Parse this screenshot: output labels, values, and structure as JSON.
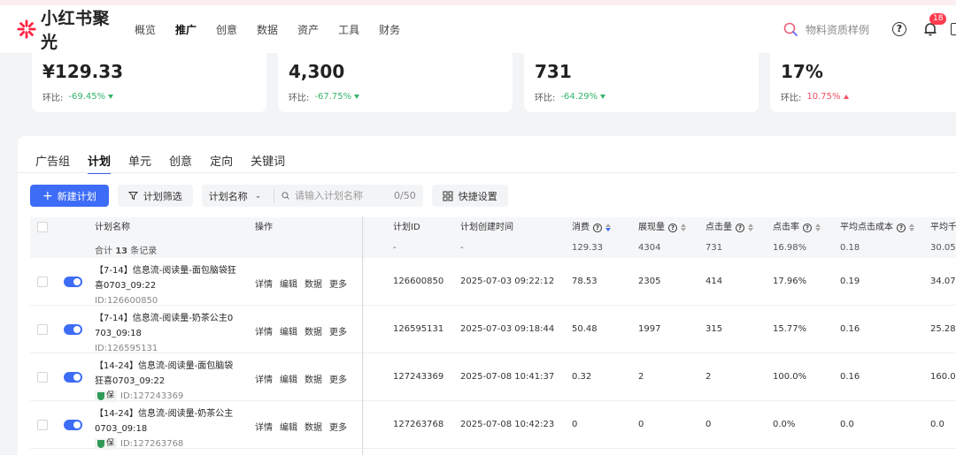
{
  "header": {
    "logo_text": "小红书聚光",
    "nav": [
      "概览",
      "推广",
      "创意",
      "数据",
      "资产",
      "工具",
      "财务"
    ],
    "active_nav": "推广",
    "search_placeholder": "物料资质样例",
    "notification_count": "18",
    "colors": {
      "brand": "#ff2442",
      "primary": "#3d6cf6"
    }
  },
  "metrics": [
    {
      "value": "¥129.33",
      "cmp_label": "环比:",
      "cmp_value": "-69.45%",
      "trend": "down"
    },
    {
      "value": "4,300",
      "cmp_label": "环比:",
      "cmp_value": "-67.75%",
      "trend": "down"
    },
    {
      "value": "731",
      "cmp_label": "环比:",
      "cmp_value": "-64.29%",
      "trend": "down"
    },
    {
      "value": "17%",
      "cmp_label": "环比:",
      "cmp_value": "10.75%",
      "trend": "up"
    }
  ],
  "tabs": [
    "广告组",
    "计划",
    "单元",
    "创意",
    "定向",
    "关键词"
  ],
  "active_tab": "计划",
  "toolbar": {
    "new_plan": "新建计划",
    "filter": "计划筛选",
    "search_field": "计划名称",
    "search_placeholder": "请输入计划名称",
    "search_count": "0/50",
    "quick_settings": "快捷设置"
  },
  "table": {
    "columns": {
      "name": "计划名称",
      "ops": "操作",
      "id": "计划ID",
      "created": "计划创建时间",
      "cost": "消费",
      "impressions": "展现量",
      "clicks": "点击量",
      "ctr": "点击率",
      "cpc": "平均点击成本",
      "cpm": "平均千"
    },
    "summary": {
      "label_pre": "合计",
      "count": "13",
      "label_post": "条记录",
      "id": "-",
      "created": "-",
      "cost": "129.33",
      "impressions": "4304",
      "clicks": "731",
      "ctr": "16.98%",
      "cpc": "0.18",
      "cpm": "30.05"
    },
    "op_labels": [
      "详情",
      "编辑",
      "数据",
      "更多"
    ],
    "rows": [
      {
        "name_l1": "【7-14】信息流-阅读量-面包脑袋狂",
        "name_l2": "喜0703_09:22",
        "id_text": "ID:126600850",
        "bao": "",
        "plan_id": "126600850",
        "created": "2025-07-03 09:22:12",
        "cost": "78.53",
        "impressions": "2305",
        "clicks": "414",
        "ctr": "17.96%",
        "cpc": "0.19",
        "cpm": "34.07"
      },
      {
        "name_l1": "【7-14】信息流-阅读量-奶茶公主0",
        "name_l2": "703_09:18",
        "id_text": "ID:126595131",
        "bao": "",
        "plan_id": "126595131",
        "created": "2025-07-03 09:18:44",
        "cost": "50.48",
        "impressions": "1997",
        "clicks": "315",
        "ctr": "15.77%",
        "cpc": "0.16",
        "cpm": "25.28"
      },
      {
        "name_l1": "【14-24】信息流-阅读量-面包脑袋",
        "name_l2": "狂喜0703_09:22",
        "id_text": "ID:127243369",
        "bao": "保",
        "plan_id": "127243369",
        "created": "2025-07-08 10:41:37",
        "cost": "0.32",
        "impressions": "2",
        "clicks": "2",
        "ctr": "100.0%",
        "cpc": "0.16",
        "cpm": "160.0"
      },
      {
        "name_l1": "【14-24】信息流-阅读量-奶茶公主",
        "name_l2": "0703_09:18",
        "id_text": "ID:127263768",
        "bao": "保",
        "plan_id": "127263768",
        "created": "2025-07-08 10:42:23",
        "cost": "0",
        "impressions": "0",
        "clicks": "0",
        "ctr": "0.0%",
        "cpc": "0.0",
        "cpm": "0.0"
      }
    ]
  }
}
